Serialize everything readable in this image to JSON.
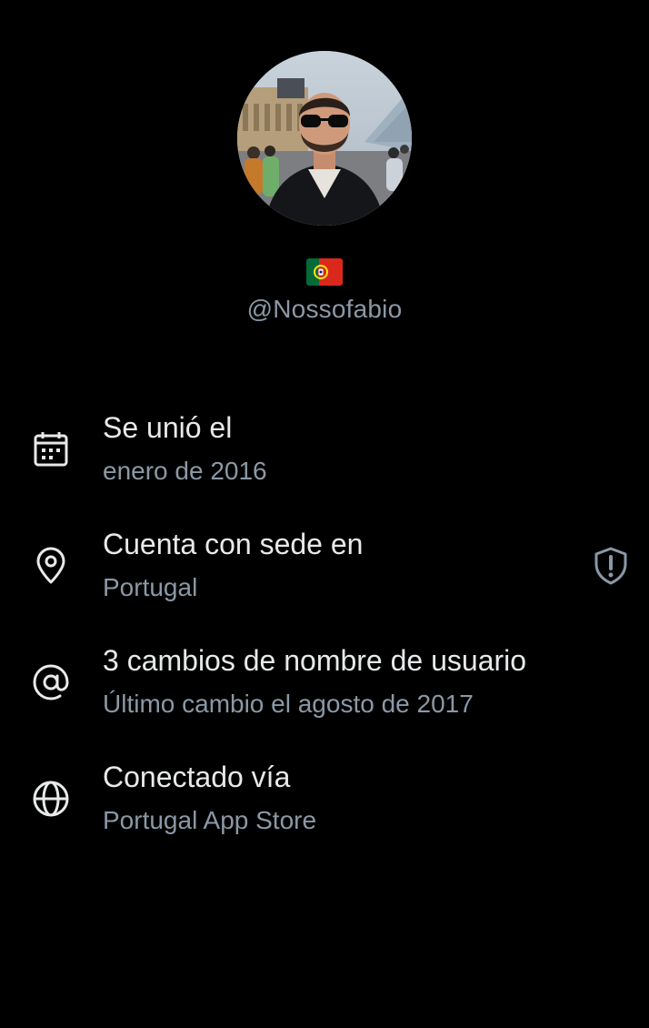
{
  "profile": {
    "flag_emoji": "🇵🇹",
    "handle": "@Nossofabio"
  },
  "about": {
    "joined": {
      "title": "Se unió el",
      "value": "enero de 2016",
      "icon": "calendar-icon"
    },
    "based_in": {
      "title": "Cuenta con sede en",
      "value": "Portugal",
      "icon": "location-pin-icon",
      "badge_icon": "shield-alert-icon"
    },
    "username_changes": {
      "title": "3 cambios de nombre de usuario",
      "value": "Último cambio el agosto de 2017",
      "icon": "at-sign-icon"
    },
    "connected_via": {
      "title": "Conectado vía",
      "value": "Portugal App Store",
      "icon": "globe-icon"
    }
  },
  "colors": {
    "background": "#000000",
    "primary_text": "#e7e9ea",
    "secondary_text": "#8b98a5"
  }
}
